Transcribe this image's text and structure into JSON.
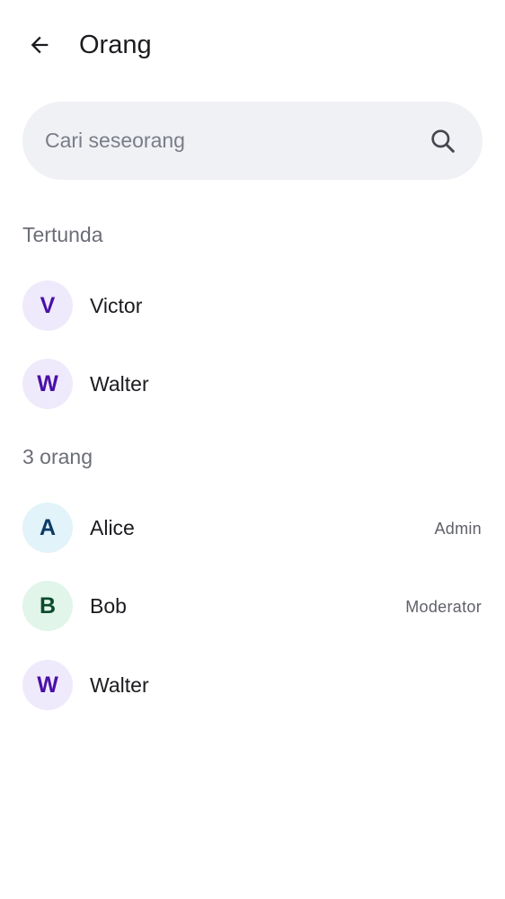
{
  "header": {
    "title": "Orang",
    "back_icon": "arrow-left-icon"
  },
  "search": {
    "placeholder": "Cari seseorang",
    "value": "",
    "icon": "search-icon"
  },
  "pending": {
    "header": "Tertunda",
    "people": [
      {
        "initial": "V",
        "name": "Victor",
        "role": "",
        "color": "#4a0fa8"
      },
      {
        "initial": "W",
        "name": "Walter",
        "role": "",
        "color": "#4a0fa8"
      }
    ]
  },
  "members": {
    "header": "3 orang",
    "people": [
      {
        "initial": "A",
        "name": "Alice",
        "role": "Admin",
        "color": "#0a3b66"
      },
      {
        "initial": "B",
        "name": "Bob",
        "role": "Moderator",
        "color": "#0b4a2c"
      },
      {
        "initial": "W",
        "name": "Walter",
        "role": "",
        "color": "#4a0fa8"
      }
    ]
  }
}
